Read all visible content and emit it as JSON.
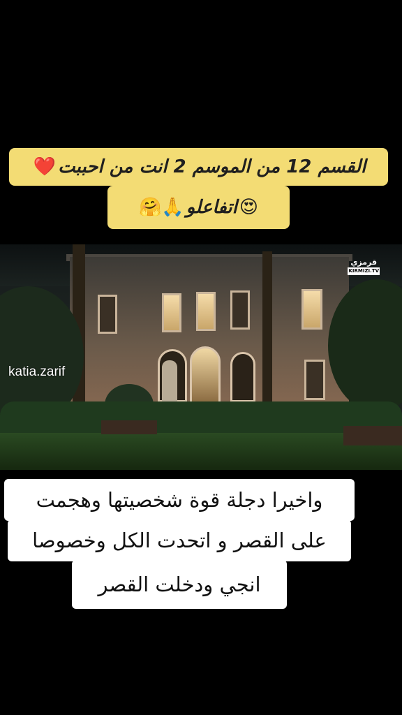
{
  "title": {
    "line1": "القسم 12 من الموسم 2 انت من احببت",
    "line1_emoji": "❤️",
    "line2": "اتفاعلو",
    "line2_emoji_start": "😍",
    "line2_emoji_end": "🙏🤗"
  },
  "video": {
    "channel_logo_text": "قرمزي",
    "channel_logo_sub": "KIRMIZI.TV"
  },
  "watermark": "katia.zarif",
  "subtitles": {
    "line1": "واخيرا دجلة قوة شخصيتها وهجمت",
    "line2": "على القصر و اتحدت الكل وخصوصا",
    "line3": "انجي  ودخلت القصر"
  },
  "colors": {
    "banner_yellow": "#f3dc74",
    "background": "#000000",
    "subtitle_bg": "#ffffff"
  }
}
